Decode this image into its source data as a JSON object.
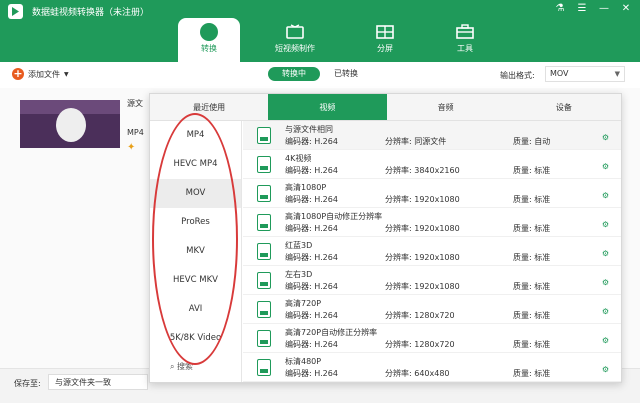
{
  "app": {
    "title": "数据蛙视频转换器（未注册）"
  },
  "window_controls": [
    "⚗",
    "☰",
    "—",
    "✕"
  ],
  "nav": [
    {
      "label": "转换",
      "active": true
    },
    {
      "label": "短视频制作",
      "active": false
    },
    {
      "label": "分屏",
      "active": false
    },
    {
      "label": "工具",
      "active": false
    }
  ],
  "toolbar": {
    "add_file": "添加文件",
    "converting": "转换中",
    "converted": "已转换",
    "output_format_label": "输出格式:",
    "output_format_value": "MOV"
  },
  "file": {
    "name": "源文",
    "format": "MP4"
  },
  "bottom": {
    "save_to_label": "保存至:",
    "save_to_value": "与源文件夹一致"
  },
  "panel": {
    "category_tabs": [
      "最近使用",
      "视频",
      "音频",
      "设备"
    ],
    "active_category": 1,
    "formats": [
      "MP4",
      "HEVC MP4",
      "MOV",
      "ProRes",
      "MKV",
      "HEVC MKV",
      "AVI",
      "5K/8K Video"
    ],
    "active_format": 2,
    "search_label": "搜索",
    "presets": [
      {
        "title": "与源文件相同",
        "encoder": "编码器: H.264",
        "resolution": "分辨率: 同源文件",
        "quality": "质量: 自动"
      },
      {
        "title": "4K视频",
        "encoder": "编码器: H.264",
        "resolution": "分辨率: 3840x2160",
        "quality": "质量: 标准"
      },
      {
        "title": "高清1080P",
        "encoder": "编码器: H.264",
        "resolution": "分辨率: 1920x1080",
        "quality": "质量: 标准"
      },
      {
        "title": "高清1080P自动修正分辨率",
        "encoder": "编码器: H.264",
        "resolution": "分辨率: 1920x1080",
        "quality": "质量: 标准"
      },
      {
        "title": "红蓝3D",
        "encoder": "编码器: H.264",
        "resolution": "分辨率: 1920x1080",
        "quality": "质量: 标准"
      },
      {
        "title": "左右3D",
        "encoder": "编码器: H.264",
        "resolution": "分辨率: 1920x1080",
        "quality": "质量: 标准"
      },
      {
        "title": "高清720P",
        "encoder": "编码器: H.264",
        "resolution": "分辨率: 1280x720",
        "quality": "质量: 标准"
      },
      {
        "title": "高清720P自动修正分辨率",
        "encoder": "编码器: H.264",
        "resolution": "分辨率: 1280x720",
        "quality": "质量: 标准"
      },
      {
        "title": "标清480P",
        "encoder": "编码器: H.264",
        "resolution": "分辨率: 640x480",
        "quality": "质量: 标准"
      }
    ]
  },
  "colors": {
    "brand": "#1f9a5a",
    "accent": "#e85b1f",
    "highlight": "#d83a3a"
  }
}
